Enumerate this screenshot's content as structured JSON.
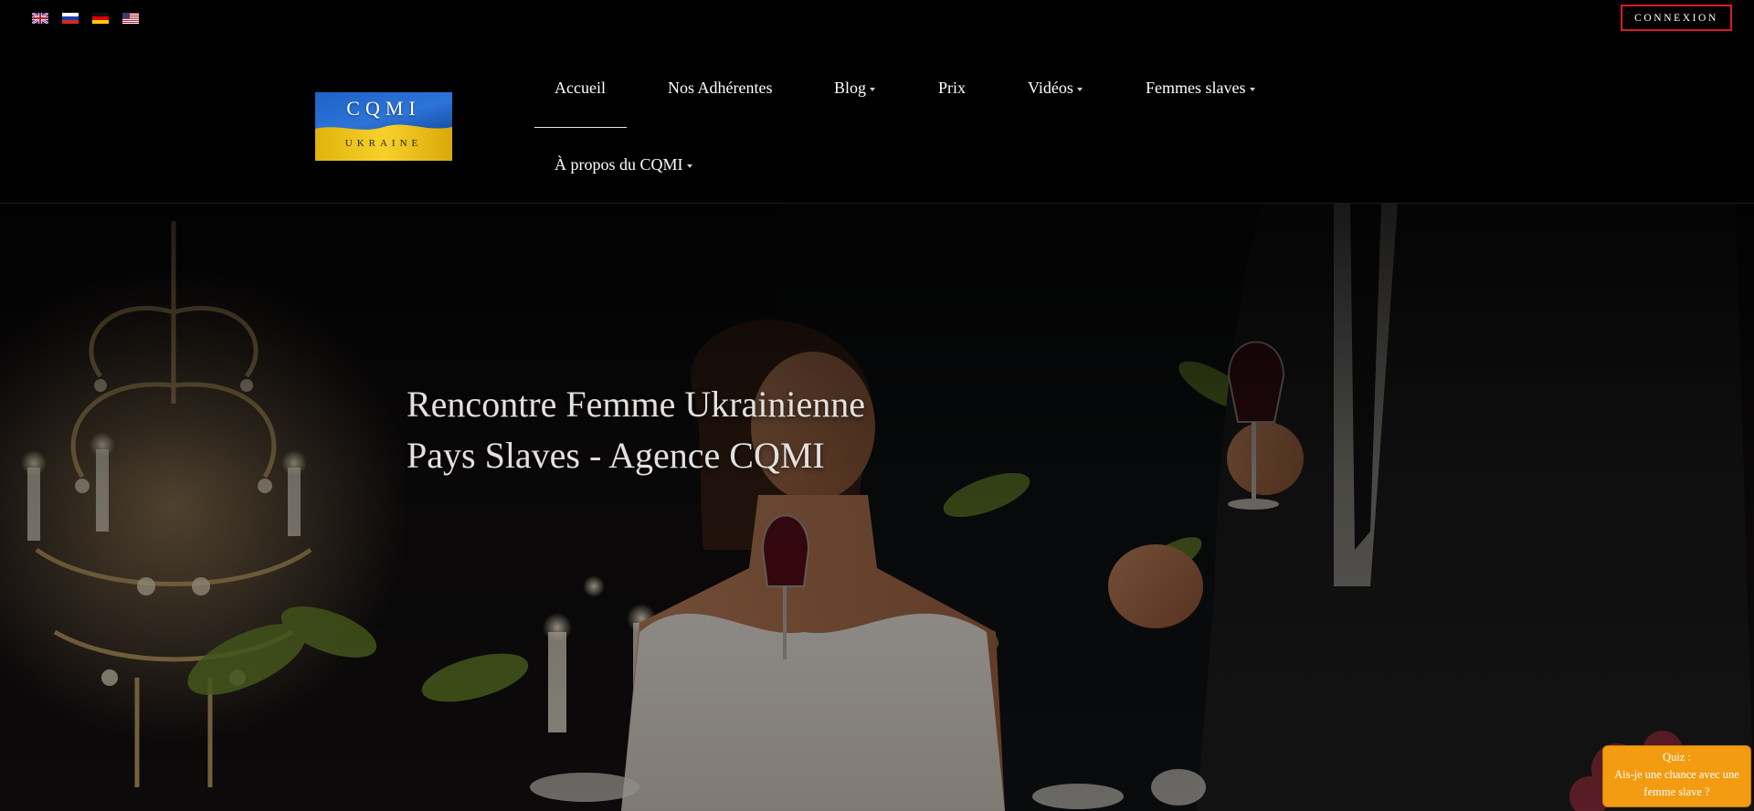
{
  "languages": [
    {
      "code": "en",
      "icon": "uk-flag-icon"
    },
    {
      "code": "ru",
      "icon": "russia-flag-icon"
    },
    {
      "code": "de",
      "icon": "germany-flag-icon"
    },
    {
      "code": "us",
      "icon": "usa-flag-icon"
    }
  ],
  "header": {
    "login_label": "CONNEXION",
    "logo": {
      "title": "CQMI",
      "subtitle": "UKRAINE"
    },
    "nav": [
      {
        "label": "Accueil",
        "active": true,
        "dropdown": false
      },
      {
        "label": "Nos Adhérentes",
        "dropdown": false
      },
      {
        "label": "Blog",
        "dropdown": true
      },
      {
        "label": "Prix",
        "dropdown": false
      },
      {
        "label": "Vidéos",
        "dropdown": true
      },
      {
        "label": "Femmes slaves",
        "dropdown": true
      },
      {
        "label": "À propos du CQMI",
        "dropdown": true
      }
    ]
  },
  "hero": {
    "title_line1": "Rencontre Femme Ukrainienne",
    "title_line2": "Pays Slaves - Agence CQMI"
  },
  "quiz": {
    "line1": "Quiz :",
    "line2": "Ais-je une chance avec une",
    "line3": "femme slave ?"
  },
  "colors": {
    "accent_border": "#d81b2a",
    "quiz_bg": "#f39c12",
    "flag_blue": "#1f5fbf",
    "flag_yellow": "#f2c716"
  }
}
